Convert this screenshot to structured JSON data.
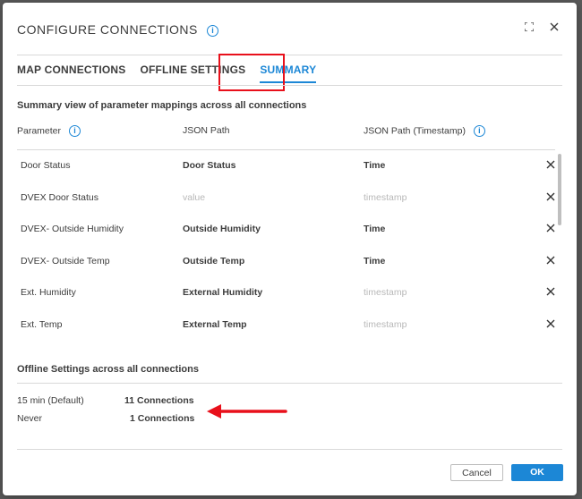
{
  "dialog": {
    "title": "CONFIGURE CONNECTIONS",
    "info_icon": "info-icon",
    "expand_icon": "expand-icon",
    "close_icon": "close-icon"
  },
  "tabs": [
    {
      "label": "MAP CONNECTIONS",
      "active": false
    },
    {
      "label": "OFFLINE SETTINGS",
      "active": false
    },
    {
      "label": "SUMMARY",
      "active": true
    }
  ],
  "summary": {
    "heading": "Summary view of parameter mappings across all connections",
    "columns": {
      "parameter": "Parameter",
      "json_path": "JSON Path",
      "json_path_timestamp": "JSON Path (Timestamp)"
    },
    "rows": [
      {
        "parameter": "Door Status",
        "json_path": "Door Status",
        "timestamp": "Time",
        "path_muted": false,
        "ts_muted": false
      },
      {
        "parameter": "DVEX Door Status",
        "json_path": "value",
        "timestamp": "timestamp",
        "path_muted": true,
        "ts_muted": true
      },
      {
        "parameter": "DVEX- Outside Humidity",
        "json_path": "Outside Humidity",
        "timestamp": "Time",
        "path_muted": false,
        "ts_muted": false
      },
      {
        "parameter": "DVEX- Outside Temp",
        "json_path": "Outside Temp",
        "timestamp": "Time",
        "path_muted": false,
        "ts_muted": false
      },
      {
        "parameter": "Ext. Humidity",
        "json_path": "External Humidity",
        "timestamp": "timestamp",
        "path_muted": false,
        "ts_muted": true
      },
      {
        "parameter": "Ext. Temp",
        "json_path": "External Temp",
        "timestamp": "timestamp",
        "path_muted": false,
        "ts_muted": true
      }
    ]
  },
  "offline": {
    "heading": "Offline Settings across all connections",
    "items": [
      {
        "label": "15 min (Default)",
        "count": "11 Connections"
      },
      {
        "label": "Never",
        "count": "1 Connections"
      }
    ]
  },
  "footer": {
    "cancel_label": "Cancel",
    "ok_label": "OK"
  },
  "colors": {
    "accent": "#1c87d6",
    "annotation": "#e8101b"
  }
}
